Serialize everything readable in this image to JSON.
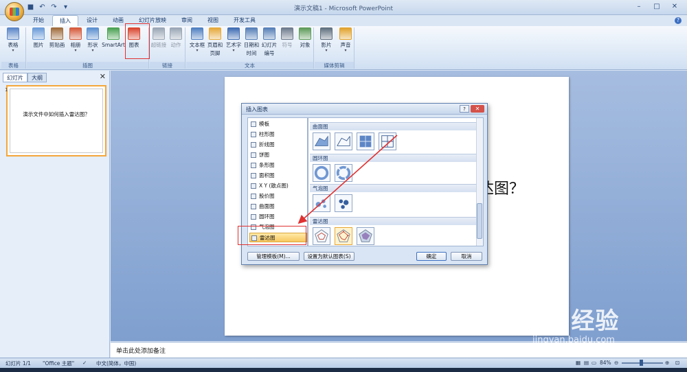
{
  "window": {
    "title": "演示文稿1 - Microsoft PowerPoint",
    "controls": [
      "–",
      "□",
      "✕"
    ]
  },
  "tabs": [
    {
      "label": "开始",
      "active": false
    },
    {
      "label": "插入",
      "active": true
    },
    {
      "label": "设计",
      "active": false
    },
    {
      "label": "动画",
      "active": false
    },
    {
      "label": "幻灯片放映",
      "active": false
    },
    {
      "label": "审阅",
      "active": false
    },
    {
      "label": "视图",
      "active": false
    },
    {
      "label": "开发工具",
      "active": false
    }
  ],
  "ribbon": {
    "groups": [
      "表格",
      "插图",
      "链接",
      "文本",
      "媒体剪辑"
    ],
    "buttons": [
      {
        "label": "表格",
        "sub": "▾",
        "icon": "table-icon",
        "color": "#5b86c9"
      },
      {
        "label": "图片",
        "sub": "",
        "icon": "picture-icon",
        "color": "#6a9ad8"
      },
      {
        "label": "剪贴画",
        "sub": "",
        "icon": "clipart-icon",
        "color": "#a06c3c"
      },
      {
        "label": "相册",
        "sub": "▾",
        "icon": "album-icon",
        "color": "#d55a3b"
      },
      {
        "label": "形状",
        "sub": "▾",
        "icon": "shapes-icon",
        "color": "#5a8ed0"
      },
      {
        "label": "SmartArt",
        "sub": "",
        "icon": "smartart-icon",
        "color": "#4aa152"
      },
      {
        "label": "图表",
        "sub": "",
        "icon": "chart-icon",
        "color": "#d9452f"
      },
      {
        "label": "超链接",
        "sub": "",
        "icon": "hyperlink-icon",
        "color": "#9aa6b6",
        "dim": true
      },
      {
        "label": "动作",
        "sub": "",
        "icon": "action-icon",
        "color": "#9aa6b6",
        "dim": true
      },
      {
        "label": "文本框",
        "sub": "▾",
        "icon": "textbox-icon",
        "color": "#4f7fc2"
      },
      {
        "label": "页眉和",
        "sub": "页脚",
        "icon": "header-footer-icon",
        "color": "#e6a93a"
      },
      {
        "label": "艺术字",
        "sub": "▾",
        "icon": "wordart-icon",
        "color": "#3f6db3"
      },
      {
        "label": "日期和",
        "sub": "时间",
        "icon": "datetime-icon",
        "color": "#567fb8"
      },
      {
        "label": "幻灯片",
        "sub": "编号",
        "icon": "slide-number-icon",
        "color": "#567fb8"
      },
      {
        "label": "符号",
        "sub": "",
        "icon": "symbol-icon",
        "color": "#6d7a8c",
        "dim": true
      },
      {
        "label": "对象",
        "sub": "",
        "icon": "object-icon",
        "color": "#5e9b5a"
      },
      {
        "label": "影片",
        "sub": "▾",
        "icon": "movie-icon",
        "color": "#60707f"
      },
      {
        "label": "声音",
        "sub": "▾",
        "icon": "sound-icon",
        "color": "#e1a22c"
      }
    ]
  },
  "panel": {
    "tabs": [
      "幻灯片",
      "大纲"
    ],
    "close": "✕",
    "slide_number": "1",
    "thumb_text": "演示文件中如何插入雷达图？"
  },
  "slide": {
    "title_partial": "达图？"
  },
  "notes": {
    "placeholder": "单击此处添加备注"
  },
  "status": {
    "slide": "幻灯片 1/1",
    "theme": "\"Office 主题\"",
    "language": "中文(简体，中国)",
    "zoom": "84%"
  },
  "watermark": {
    "logo": "Bai 经验",
    "url": "jingyan.baidu.com"
  },
  "dialog": {
    "title": "插入图表",
    "help": "?",
    "close": "✕",
    "categories": [
      {
        "label": "模板",
        "icon": "folder-icon"
      },
      {
        "label": "柱形图",
        "icon": "column-chart-icon"
      },
      {
        "label": "折线图",
        "icon": "line-chart-icon"
      },
      {
        "label": "饼图",
        "icon": "pie-chart-icon"
      },
      {
        "label": "条形图",
        "icon": "bar-chart-icon"
      },
      {
        "label": "面积图",
        "icon": "area-chart-icon"
      },
      {
        "label": "X Y (散点图)",
        "icon": "scatter-chart-icon"
      },
      {
        "label": "股价图",
        "icon": "stock-chart-icon"
      },
      {
        "label": "曲面图",
        "icon": "surface-chart-icon"
      },
      {
        "label": "圆环图",
        "icon": "doughnut-chart-icon"
      },
      {
        "label": "气泡图",
        "icon": "bubble-chart-icon"
      },
      {
        "label": "雷达图",
        "icon": "radar-chart-icon",
        "selected": true
      }
    ],
    "sections": [
      {
        "label": "曲面图",
        "tiles": 4
      },
      {
        "label": "圆环图",
        "tiles": 2
      },
      {
        "label": "气泡图",
        "tiles": 2
      },
      {
        "label": "雷达图",
        "tiles": 3
      }
    ],
    "buttons": {
      "manage": "管理模板(M)...",
      "set_default": "设置为默认图表(S)",
      "ok": "确定",
      "cancel": "取消"
    }
  },
  "colors": {
    "highlight": "#e03030",
    "selection": "#f8c860",
    "accent": "#3c6fc2"
  }
}
